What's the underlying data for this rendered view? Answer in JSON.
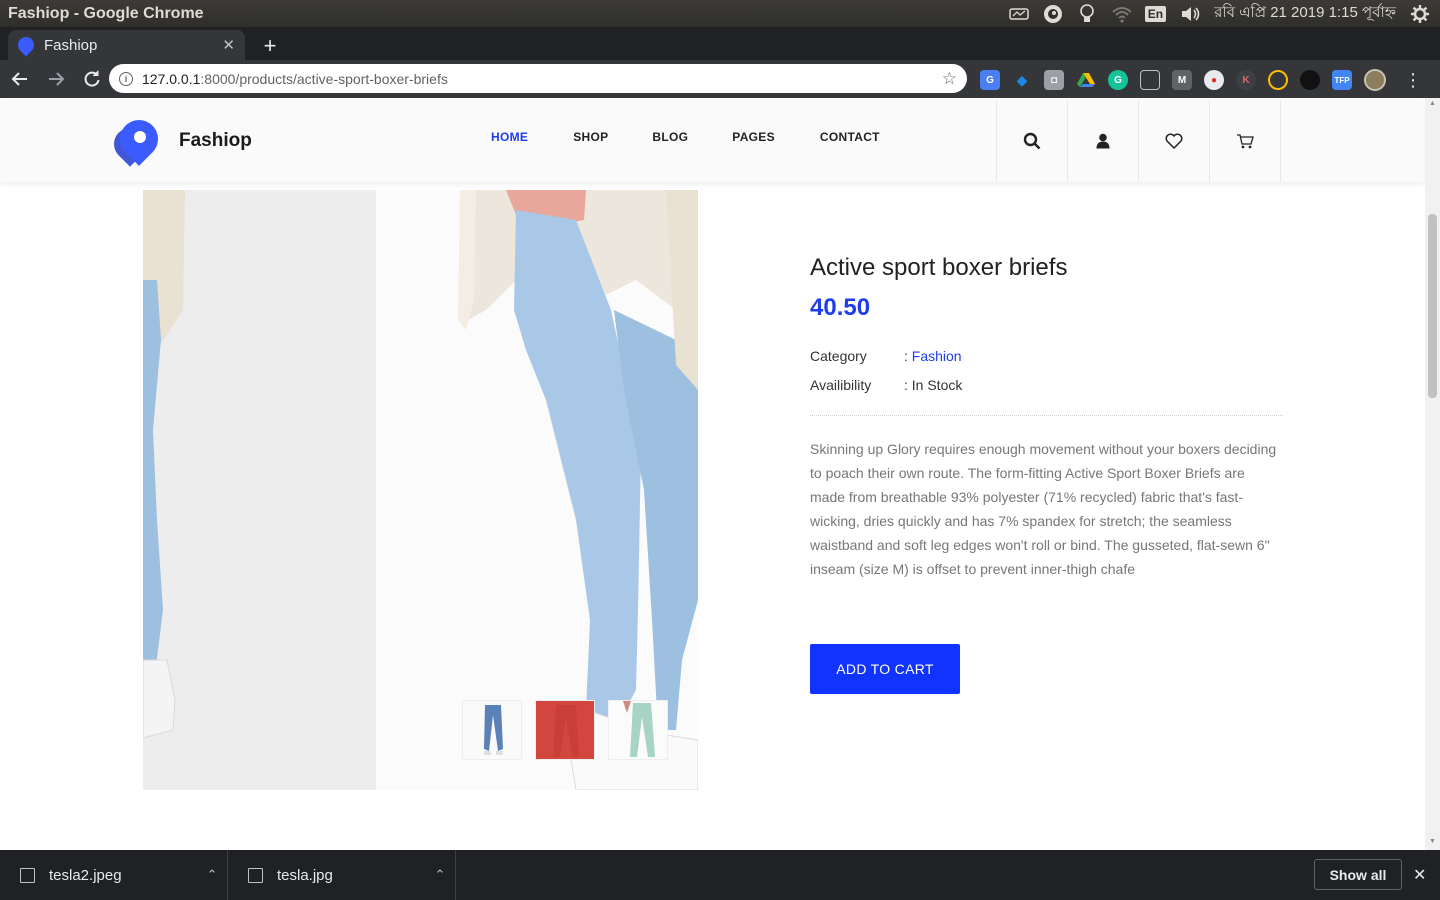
{
  "os": {
    "window_title": "Fashiop - Google Chrome",
    "lang": "En",
    "datetime": "রবি এপ্রি 21 2019  1:15 পূর্বাহ্ন"
  },
  "browser": {
    "tab_title": "Fashiop",
    "url_host": "127.0.0.1",
    "url_path": ":8000/products/active-sport-boxer-briefs"
  },
  "site": {
    "brand": "Fashiop",
    "nav": [
      "HOME",
      "SHOP",
      "BLOG",
      "PAGES",
      "CONTACT"
    ],
    "accent": "#1e3cf0"
  },
  "product": {
    "title": "Active sport boxer briefs",
    "price": "40.50",
    "category_label": "Category",
    "category_value": "Fashion",
    "availability_label": "Availibility",
    "availability_value": "In Stock",
    "description": "Skinning up Glory requires enough movement without your boxers deciding to poach their own route. The form-fitting Active Sport Boxer Briefs are made from breathable 93% polyester (71% recycled) fabric that's fast-wicking, dries quickly and has 7% spandex for stretch; the seamless waistband and soft leg edges won't roll or bind. The gusseted, flat-sewn 6\" inseam (size M) is offset to prevent inner-thigh chafe",
    "add_to_cart": "ADD TO CART"
  },
  "downloads": {
    "items": [
      "tesla2.jpeg",
      "tesla.jpg"
    ],
    "show_all": "Show all"
  }
}
